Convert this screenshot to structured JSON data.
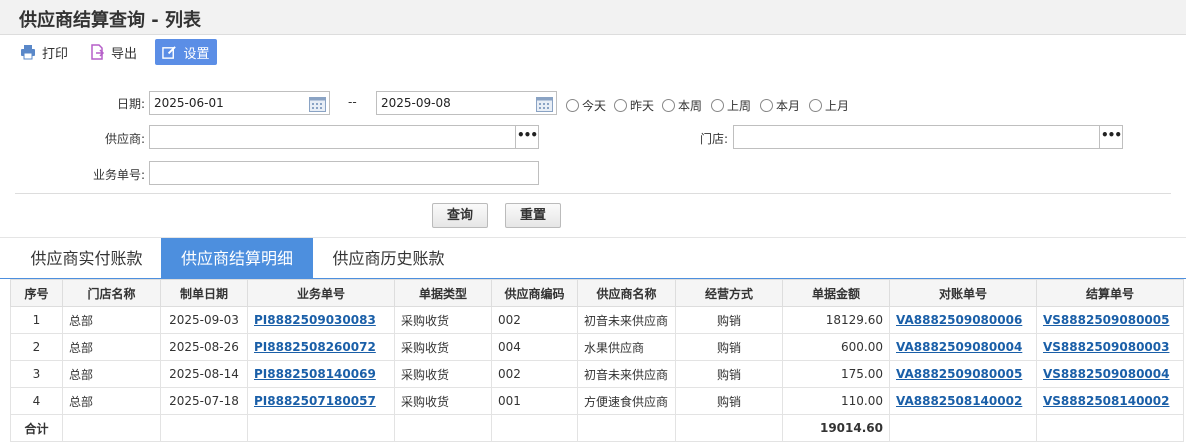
{
  "title": "供应商结算查询 - 列表",
  "toolbar": {
    "print": "打印",
    "export": "导出",
    "settings": "设置"
  },
  "form": {
    "date_label": "日期:",
    "date_from": "2025-06-01",
    "date_sep": "--",
    "date_to": "2025-09-08",
    "ranges": [
      "今天",
      "昨天",
      "本周",
      "上周",
      "本月",
      "上月"
    ],
    "supplier_label": "供应商:",
    "supplier_value": "",
    "store_label": "门店:",
    "store_value": "",
    "order_label": "业务单号:",
    "order_value": "",
    "ellipsis": "•••",
    "query": "查询",
    "reset": "重置"
  },
  "tabs": [
    "供应商实付账款",
    "供应商结算明细",
    "供应商历史账款"
  ],
  "active_tab": 1,
  "table": {
    "headers": [
      "序号",
      "门店名称",
      "制单日期",
      "业务单号",
      "单据类型",
      "供应商编码",
      "供应商名称",
      "经营方式",
      "单据金额",
      "对账单号",
      "结算单号"
    ],
    "rows": [
      [
        "1",
        "总部",
        "2025-09-03",
        "PI8882509030083",
        "采购收货",
        "002",
        "初音未来供应商",
        "购销",
        "18129.60",
        "VA8882509080006",
        "VS8882509080005"
      ],
      [
        "2",
        "总部",
        "2025-08-26",
        "PI8882508260072",
        "采购收货",
        "004",
        "水果供应商",
        "购销",
        "600.00",
        "VA8882509080004",
        "VS8882509080003"
      ],
      [
        "3",
        "总部",
        "2025-08-14",
        "PI8882508140069",
        "采购收货",
        "002",
        "初音未来供应商",
        "购销",
        "175.00",
        "VA8882509080005",
        "VS8882509080004"
      ],
      [
        "4",
        "总部",
        "2025-07-18",
        "PI8882507180057",
        "采购收货",
        "001",
        "方便速食供应商",
        "购销",
        "110.00",
        "VA8882508140002",
        "VS8882508140002"
      ]
    ],
    "total_label": "合计",
    "total_amount": "19014.60"
  }
}
